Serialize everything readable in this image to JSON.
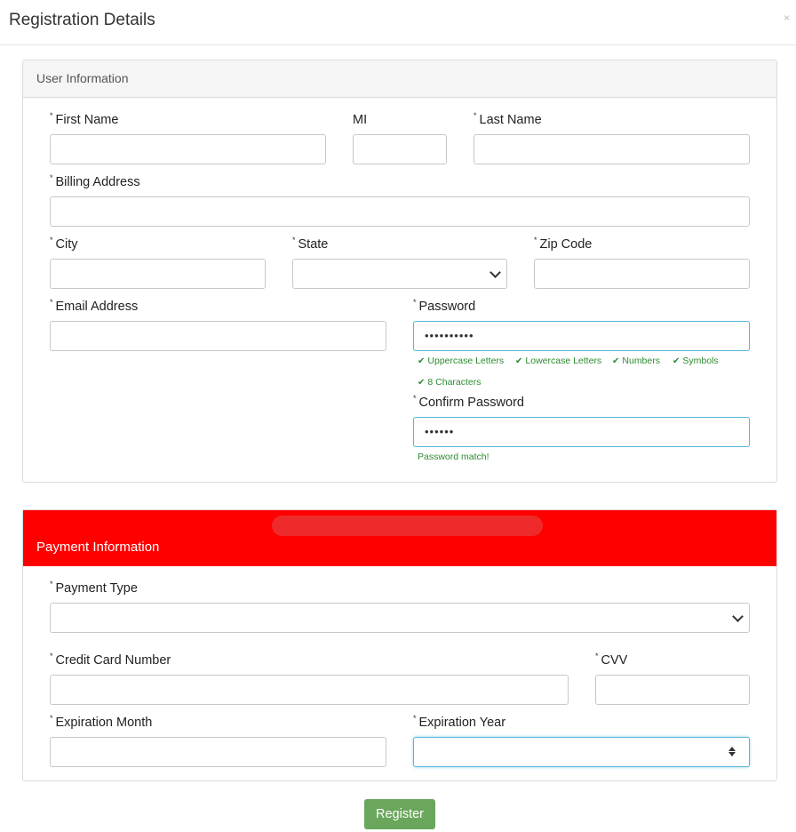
{
  "modal": {
    "title": "Registration Details",
    "close": "×"
  },
  "user": {
    "heading": "User Information",
    "labels": {
      "first_name": "First Name",
      "mi": "MI",
      "last_name": "Last Name",
      "billing": "Billing Address",
      "city": "City",
      "state": "State",
      "zip": "Zip Code",
      "email": "Email Address",
      "password": "Password",
      "confirm": "Confirm Password"
    },
    "required_mark": "*",
    "password_mask": "••••••••••",
    "confirm_mask": "••••••",
    "password_checks": [
      "Uppercase Letters",
      "Lowercase Letters",
      "Numbers",
      "Symbols",
      "8 Characters"
    ],
    "password_match": "Password match!"
  },
  "payment": {
    "heading": "Payment Information",
    "labels": {
      "type": "Payment Type",
      "card": "Credit Card Number",
      "cvv": "CVV",
      "month": "Expiration Month",
      "year": "Expiration Year"
    }
  },
  "actions": {
    "register": "Register"
  },
  "colors": {
    "payment_header": "#ff0000",
    "success": "#2e8b2e",
    "register_button": "#6aa75c",
    "focus_border": "#5ab6d8"
  },
  "icons": {
    "check": "✔"
  }
}
